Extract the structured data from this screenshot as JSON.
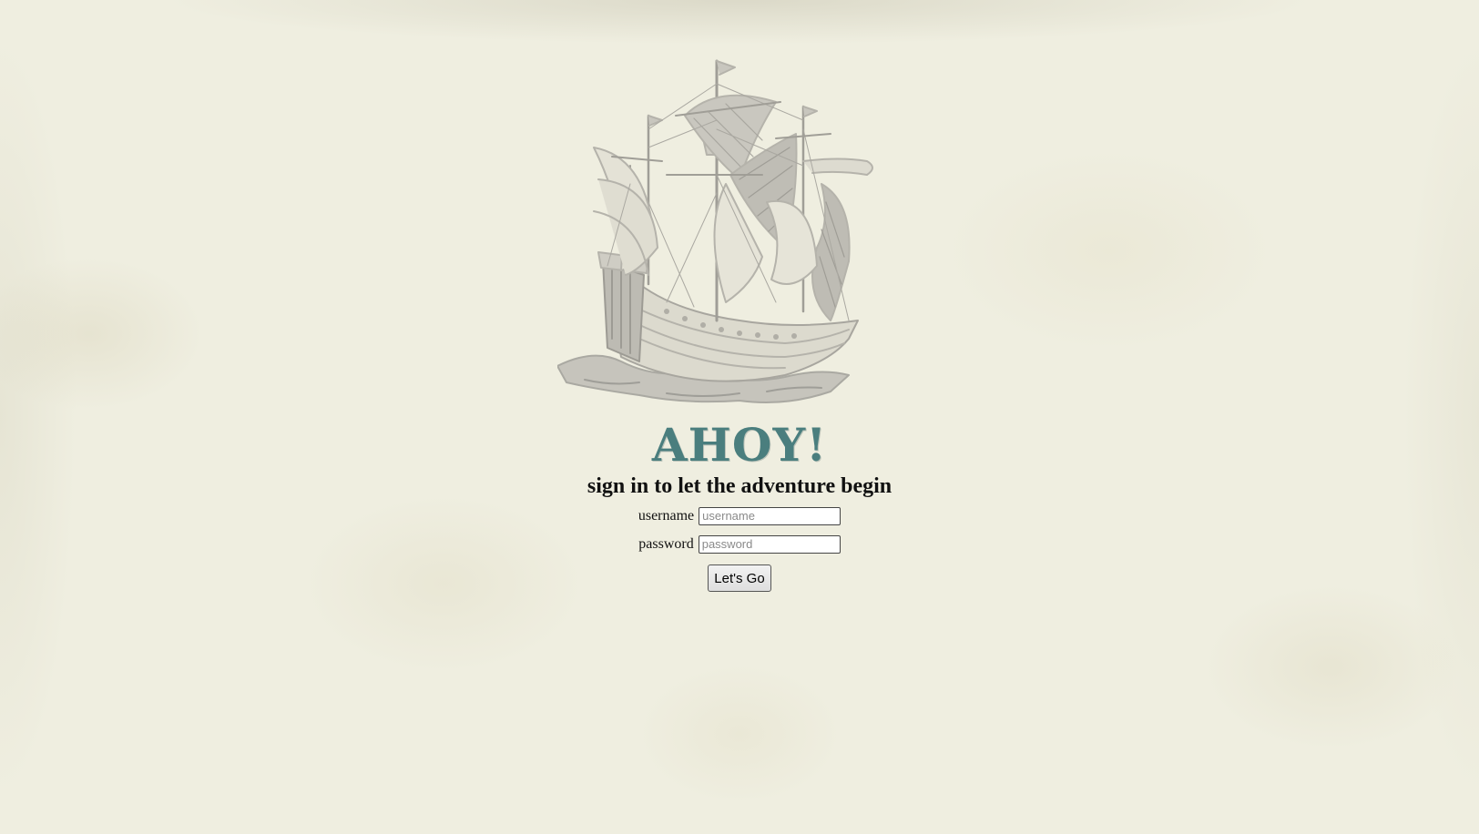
{
  "header": {
    "title": "AHOY!",
    "subtitle": "sign in to let the adventure begin"
  },
  "illustration": {
    "name": "sailing-ship-icon"
  },
  "form": {
    "username_label": "username",
    "username_placeholder": "username",
    "username_value": "",
    "password_label": "password",
    "password_placeholder": "password",
    "password_value": "",
    "submit_label": "Let's Go"
  },
  "colors": {
    "title": "#4a7e7e",
    "background": "#efeee0",
    "illustration": "#b9b7b0"
  }
}
